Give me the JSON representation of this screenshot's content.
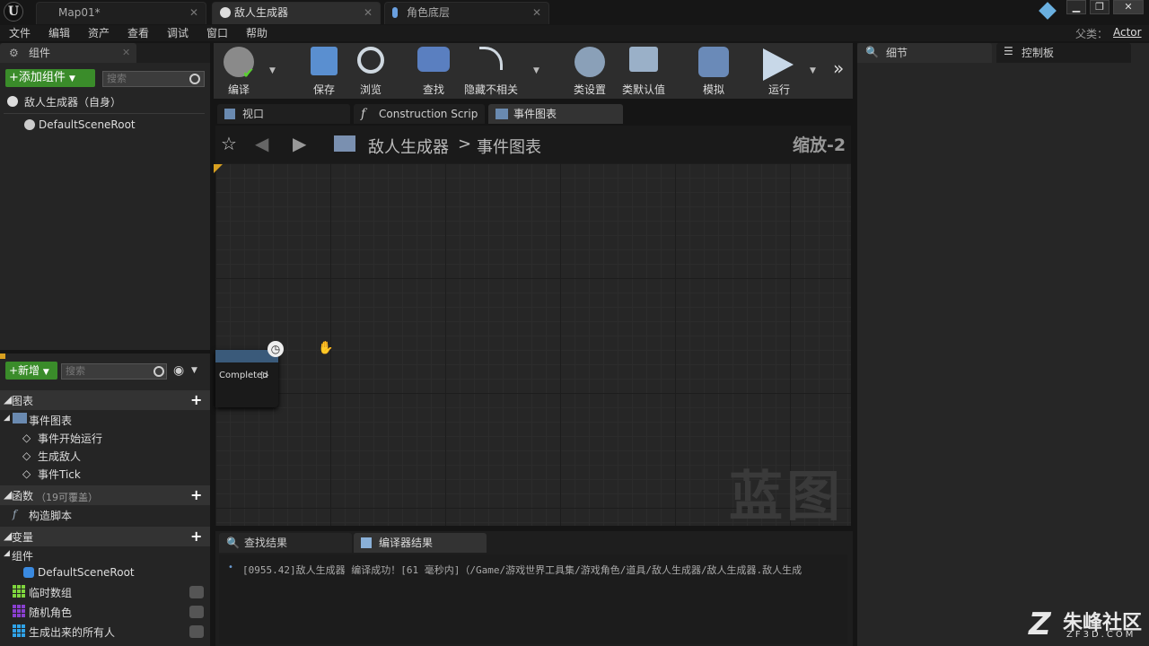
{
  "titlebar": {
    "tabs": [
      {
        "label": "Map01*"
      },
      {
        "label": "敌人生成器"
      },
      {
        "label": "角色底层"
      }
    ]
  },
  "menu": [
    "文件",
    "编辑",
    "资产",
    "查看",
    "调试",
    "窗口",
    "帮助"
  ],
  "parent": {
    "label": "父类：",
    "value": "Actor"
  },
  "components_panel": {
    "tab_label": "组件",
    "add_button": "+添加组件",
    "search_placeholder": "搜索",
    "self_item": "敌人生成器（自身）",
    "root_item": "DefaultSceneRoot"
  },
  "toolbar": {
    "buttons": [
      {
        "label": "编译"
      },
      {
        "label": "保存"
      },
      {
        "label": "浏览"
      },
      {
        "label": "查找"
      },
      {
        "label": "隐藏不相关"
      },
      {
        "label": "类设置"
      },
      {
        "label": "类默认值"
      },
      {
        "label": "模拟"
      },
      {
        "label": "运行"
      }
    ]
  },
  "doc_tabs": [
    {
      "label": "视口"
    },
    {
      "label": "Construction Scrip"
    },
    {
      "label": "事件图表"
    }
  ],
  "graph": {
    "breadcrumb_root": "敌人生成器",
    "breadcrumb_sep": ">",
    "breadcrumb_leaf": "事件图表",
    "zoom": "缩放-2",
    "watermark": "蓝图",
    "node_pin": "Completed"
  },
  "my_blueprint": {
    "new_button": "+新增",
    "search_placeholder": "搜索",
    "sections": {
      "graphs": "图表",
      "functions": "函数",
      "functions_note": "（19可覆盖）",
      "variables": "变量"
    },
    "event_graph": "事件图表",
    "events": [
      "事件开始运行",
      "生成敌人",
      "事件Tick"
    ],
    "construction_script": "构造脚本",
    "components_label": "组件",
    "component_root": "DefaultSceneRoot",
    "variables": [
      {
        "name": "临时数组",
        "color": "#7fd63c"
      },
      {
        "name": "随机角色",
        "color": "#8a3fd0"
      },
      {
        "name": "生成出来的所有人",
        "color": "#2fa3e8"
      }
    ]
  },
  "results": {
    "tabs": [
      {
        "label": "查找结果"
      },
      {
        "label": "编译器结果"
      }
    ],
    "log": "[0955.42]敌人生成器 编译成功！[61 毫秒内]（/Game/游戏世界工具集/游戏角色/道具/敌人生成器/敌人生成器.敌人生成"
  },
  "right_panel": {
    "details_tab": "细节",
    "palette_tab": "控制板"
  },
  "watermark_brand": {
    "title": "朱峰社区",
    "url": "ZF3D.COM"
  }
}
